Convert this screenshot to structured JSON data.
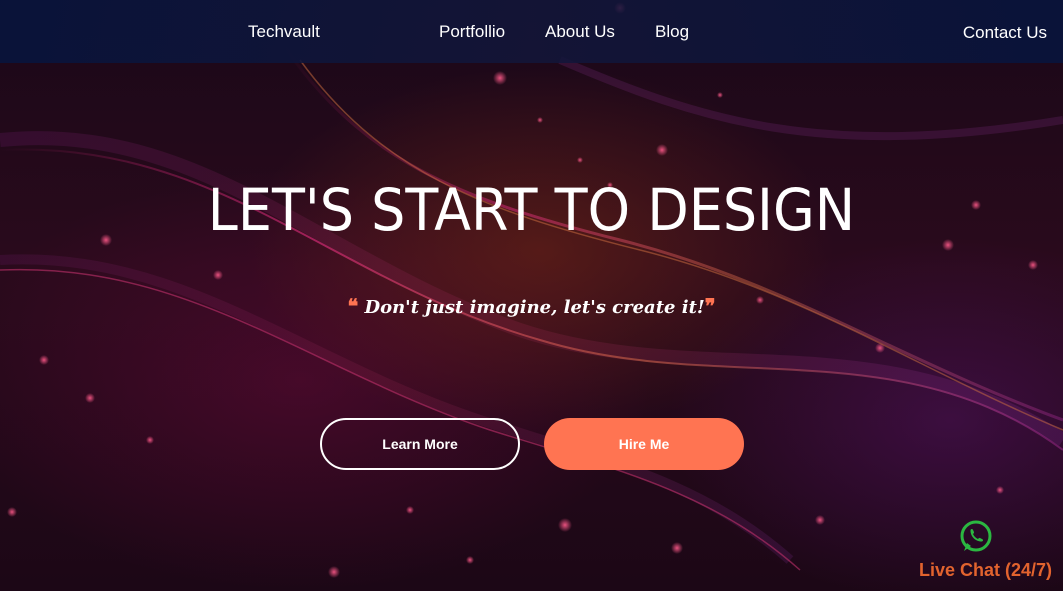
{
  "nav": {
    "brand": "Techvault",
    "items": [
      {
        "label": "Portfollio"
      },
      {
        "label": "About Us"
      },
      {
        "label": "Blog"
      }
    ],
    "contact": "Contact Us"
  },
  "hero": {
    "title": "LET'S START TO DESIGN",
    "tagline": "Don't just imagine, let's create it!",
    "quote_open": "❝",
    "quote_close": "❞",
    "buttons": {
      "learn_more": "Learn More",
      "hire_me": "Hire Me"
    }
  },
  "chat": {
    "label": "Live Chat (24/7)",
    "icon": "whatsapp-icon"
  },
  "colors": {
    "accent": "#ff7452",
    "chat_text": "#e2632e",
    "whatsapp": "#2bb741",
    "nav_bg": "#0c1540"
  }
}
